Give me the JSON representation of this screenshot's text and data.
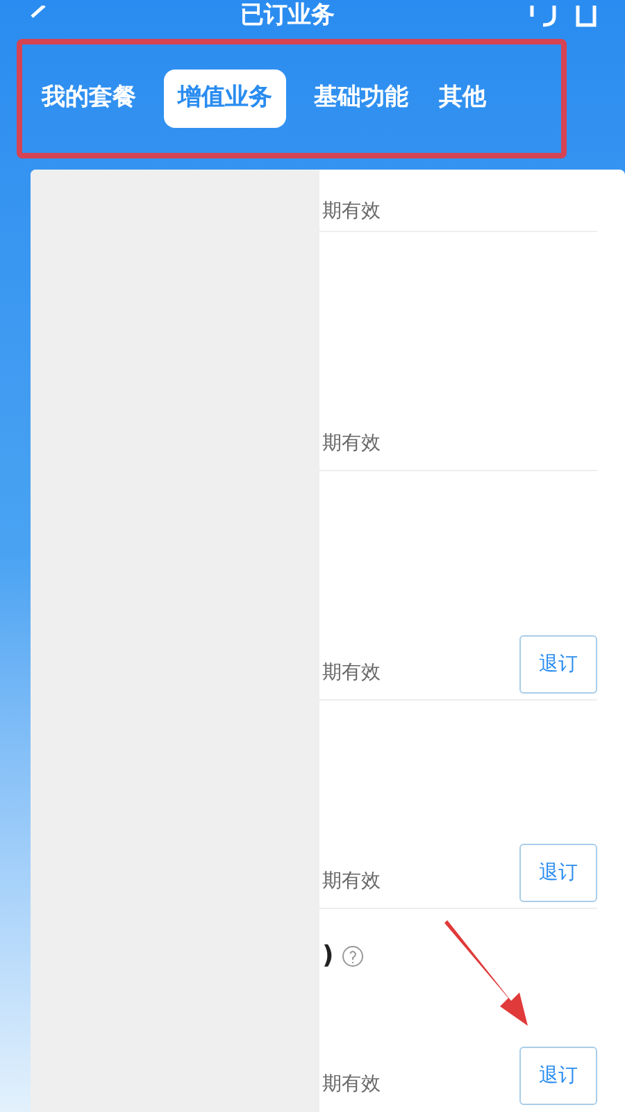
{
  "header": {
    "title": "已订业务"
  },
  "tabs": [
    {
      "label": "我的套餐",
      "selected": false
    },
    {
      "label": "增值业务",
      "selected": true
    },
    {
      "label": "基础功能",
      "selected": false
    },
    {
      "label": "其他",
      "selected": false
    }
  ],
  "rows": [
    {
      "validity": "期有效"
    },
    {
      "validity": "期有效"
    },
    {
      "validity": "期有效",
      "action": "退订"
    },
    {
      "validity": "期有效",
      "action": "退订"
    },
    {
      "title": ")",
      "help": true,
      "validity": "期有效",
      "action": "退订"
    }
  ]
}
